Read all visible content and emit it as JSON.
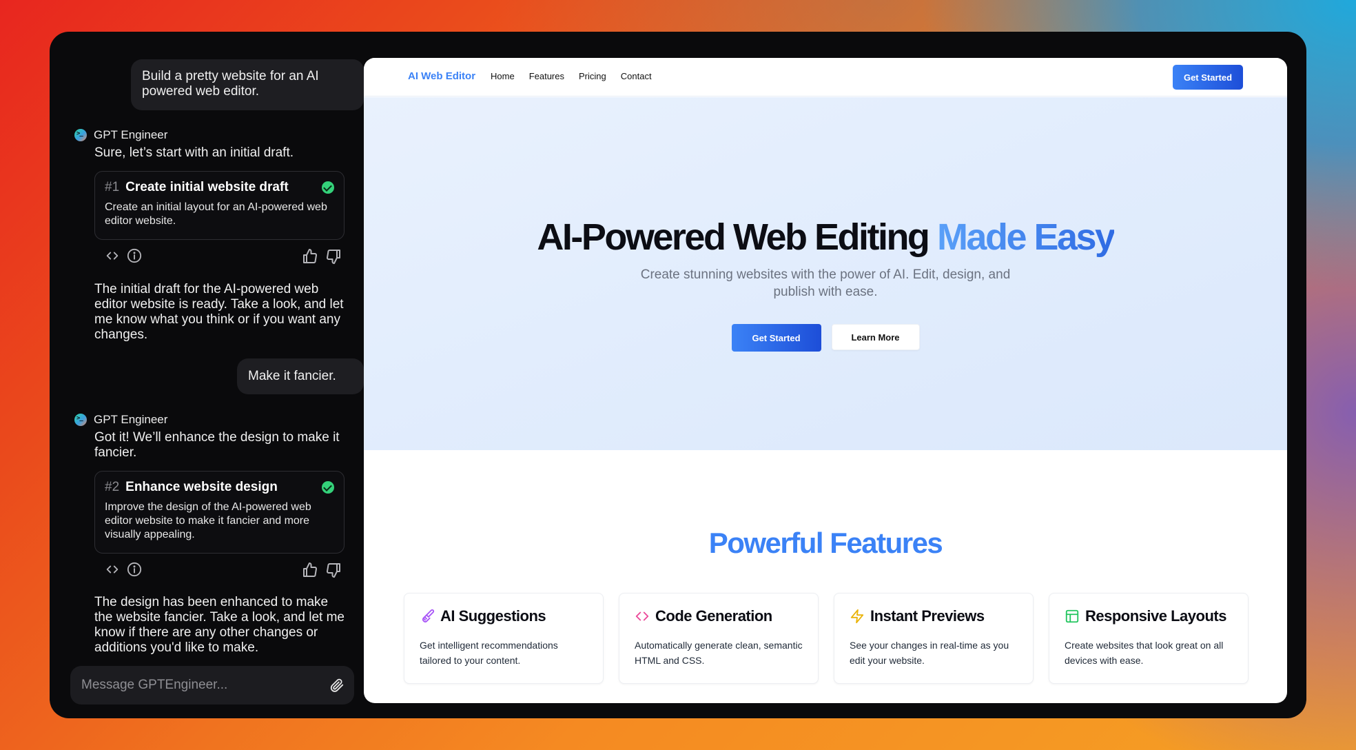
{
  "chat": {
    "messages": [
      {
        "role": "user",
        "text": "Build a pretty website for an AI powered web editor."
      },
      {
        "role": "assistant",
        "name": "GPT Engineer",
        "text": "Sure, let’s start with an initial draft.",
        "task": {
          "number": "#1",
          "title": "Create initial website draft",
          "description": "Create an initial layout for an AI-powered web editor website.",
          "status": "done"
        },
        "followup": "The initial draft for the AI-powered web editor website is ready. Take a look, and let me know what you think or if you want any changes."
      },
      {
        "role": "user",
        "text": "Make it fancier."
      },
      {
        "role": "assistant",
        "name": "GPT Engineer",
        "text": "Got it! We’ll enhance the design to make it fancier.",
        "task": {
          "number": "#2",
          "title": "Enhance website design",
          "description": "Improve the design of the AI-powered web editor website to make it fancier and more visually appealing.",
          "status": "done"
        },
        "followup": "The design has been enhanced to make the website fancier. Take a look, and let me know if there are any other changes or additions you'd like to make."
      }
    ],
    "composer": {
      "placeholder": "Message GPTEngineer...",
      "value": ""
    },
    "icons": [
      "code-icon",
      "info-icon",
      "thumbs-up-icon",
      "thumbs-down-icon",
      "paperclip-icon",
      "check-circle-icon"
    ]
  },
  "preview": {
    "nav": {
      "brand": "AI Web Editor",
      "links": [
        "Home",
        "Features",
        "Pricing",
        "Contact"
      ],
      "cta": "Get Started"
    },
    "hero": {
      "title_main": "AI-Powered Web Editing",
      "title_accent": "Made Easy",
      "subtitle": "Create stunning websites with the power of AI. Edit, design, and publish with ease.",
      "primary_button": "Get Started",
      "secondary_button": "Learn More"
    },
    "features": {
      "title": "Powerful Features",
      "items": [
        {
          "icon": "paintbrush-icon",
          "icon_color": "#a855f7",
          "title": "AI Suggestions",
          "description": "Get intelligent recommendations tailored to your content."
        },
        {
          "icon": "code-icon",
          "icon_color": "#ec4899",
          "title": "Code Generation",
          "description": "Automatically generate clean, semantic HTML and CSS."
        },
        {
          "icon": "lightning-icon",
          "icon_color": "#eab308",
          "title": "Instant Previews",
          "description": "See your changes in real-time as you edit your website."
        },
        {
          "icon": "layout-icon",
          "icon_color": "#22c55e",
          "title": "Responsive Layouts",
          "description": "Create websites that look great on all devices with ease."
        }
      ]
    }
  },
  "colors": {
    "accent": "#3b82f6",
    "accent_dark": "#1d4ed8",
    "success": "#34d17a",
    "chat_bg": "#0a0a0c"
  }
}
